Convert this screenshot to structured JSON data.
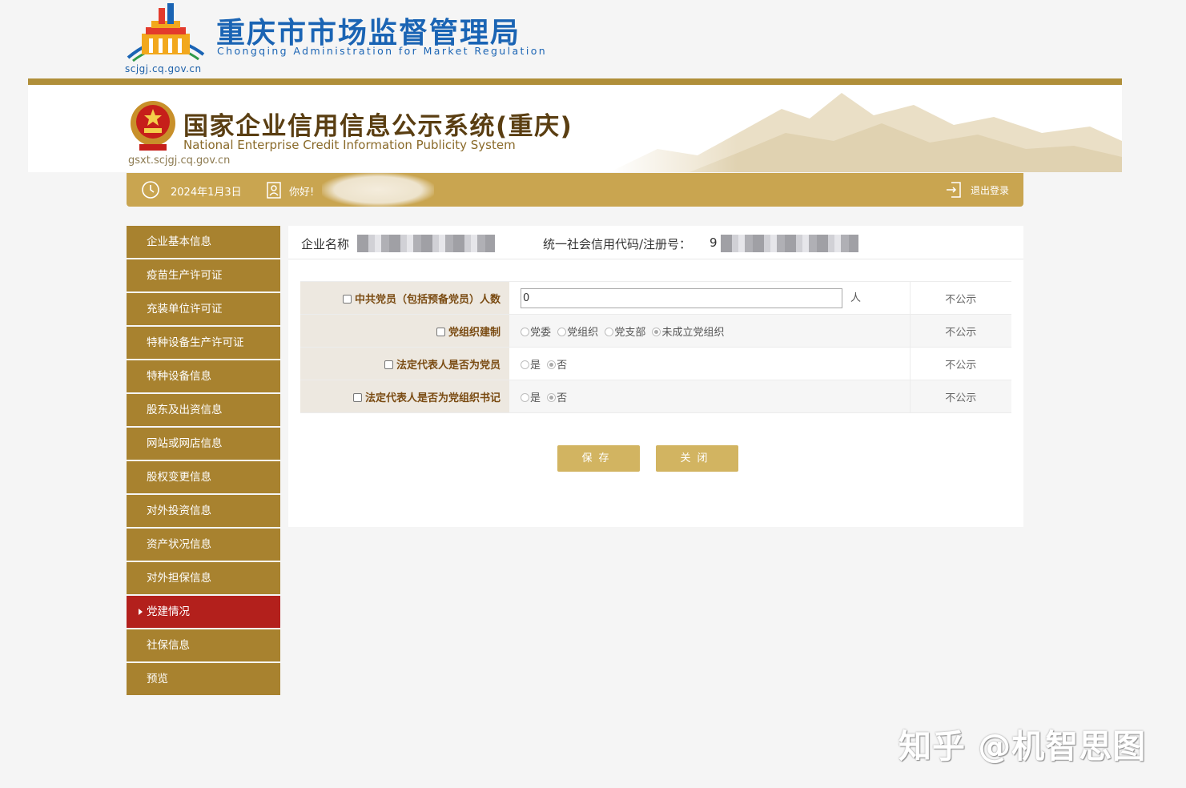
{
  "agency": {
    "title": "重庆市市场监督管理局",
    "title_en": "Chongqing  Administration for Market Regulation",
    "domain": "scjgj.cq.gov.cn"
  },
  "banner": {
    "title": "国家企业信用信息公示系统(重庆)",
    "title_en": "National Enterprise Credit Information Publicity System",
    "domain": "gsxt.scjgj.cq.gov.cn"
  },
  "userbar": {
    "date": "2024年1月3日",
    "hello": "你好!",
    "logout": "退出登录"
  },
  "sidebar": {
    "items": [
      {
        "label": "企业基本信息"
      },
      {
        "label": "疫苗生产许可证"
      },
      {
        "label": "充装单位许可证"
      },
      {
        "label": "特种设备生产许可证"
      },
      {
        "label": "特种设备信息"
      },
      {
        "label": "股东及出资信息"
      },
      {
        "label": "网站或网店信息"
      },
      {
        "label": "股权变更信息"
      },
      {
        "label": "对外投资信息"
      },
      {
        "label": "资产状况信息"
      },
      {
        "label": "对外担保信息"
      },
      {
        "label": "党建情况",
        "active": true
      },
      {
        "label": "社保信息"
      },
      {
        "label": "预览"
      }
    ]
  },
  "enterprise": {
    "name_label": "企业名称",
    "code_label": "统一社会信用代码/注册号：",
    "code_prefix": "9"
  },
  "form": {
    "rows": [
      {
        "label": "中共党员（包括预备党员）人数",
        "value": "0",
        "unit": "人",
        "publicity": "不公示"
      },
      {
        "label": "党组织建制",
        "options": [
          "党委",
          "党组织",
          "党支部",
          "未成立党组织"
        ],
        "selected": "未成立党组织",
        "publicity": "不公示"
      },
      {
        "label": "法定代表人是否为党员",
        "options": [
          "是",
          "否"
        ],
        "selected": "否",
        "publicity": "不公示"
      },
      {
        "label": "法定代表人是否为党组织书记",
        "options": [
          "是",
          "否"
        ],
        "selected": "否",
        "publicity": "不公示"
      }
    ]
  },
  "buttons": {
    "save": "保存",
    "close": "关闭"
  },
  "watermark": "知乎 @机智思图",
  "colors": {
    "agency_blue": "#1a64b4",
    "gold": "#c9a550",
    "sidebar": "#a8822f",
    "active": "#b3201c",
    "button": "#d2b461"
  }
}
